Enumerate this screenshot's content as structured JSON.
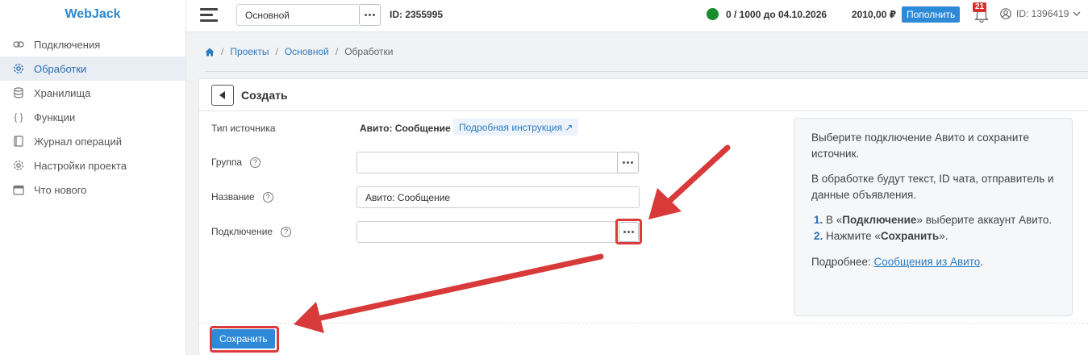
{
  "app": {
    "logo": "WebJack"
  },
  "sidebar": {
    "items": [
      {
        "label": "Подключения",
        "icon": "link-icon"
      },
      {
        "label": "Обработки",
        "icon": "gear-icon",
        "active": true
      },
      {
        "label": "Хранилища",
        "icon": "database-icon"
      },
      {
        "label": "Функции",
        "icon": "braces-icon"
      },
      {
        "label": "Журнал операций",
        "icon": "journal-icon"
      },
      {
        "label": "Настройки проекта",
        "icon": "gear-icon"
      },
      {
        "label": "Что нового",
        "icon": "calendar-icon"
      }
    ]
  },
  "header": {
    "project": "Основной",
    "id_text": "ID: 2355995",
    "quota": "0 / 1000 до 04.10.2026",
    "balance": "2010,00 ₽",
    "topup_label": "Пополнить",
    "notifications": "21",
    "user_id": "ID: 1396419"
  },
  "breadcrumb": {
    "items": [
      "Проекты",
      "Основной",
      "Обработки"
    ]
  },
  "form": {
    "title": "Создать",
    "source_type_label": "Тип источника",
    "source_type_value": "Авито: Сообщение",
    "instruction_link": "Подробная инструкция ↗",
    "group_label": "Группа",
    "group_value": "",
    "name_label": "Название",
    "name_value": "Авито: Сообщение",
    "connection_label": "Подключение",
    "connection_value": "",
    "save_label": "Сохранить"
  },
  "info": {
    "p1": "Выберите подключение Авито и сохраните источник.",
    "p2": "В обработке будут текст, ID чата, отправитель и данные объявления.",
    "step1_pre": "В «",
    "step1_bold": "Подключение",
    "step1_post": "» выберите аккаунт Авито.",
    "step2_pre": "Нажмите «",
    "step2_bold": "Сохранить",
    "step2_post": "».",
    "more_label": "Подробнее: ",
    "more_link": "Сообщения из Авито",
    "more_end": "."
  },
  "colors": {
    "accent": "#2e89d6",
    "highlight": "#dc3a3a",
    "status": "#1a8c2d"
  }
}
